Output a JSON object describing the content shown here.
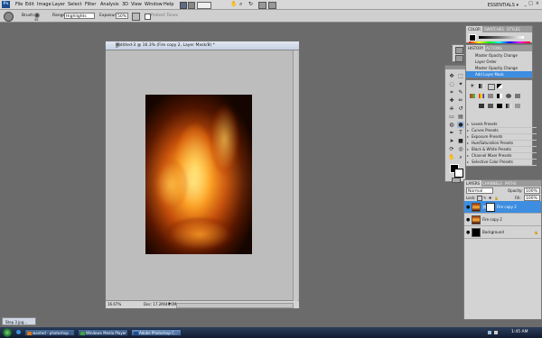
{
  "menu": {
    "ps_logo": "Ps",
    "items": [
      "File",
      "Edit",
      "Image",
      "Layer",
      "Select",
      "Filter",
      "Analysis",
      "3D",
      "View",
      "Window",
      "Help"
    ],
    "workspace": "ESSENTIALS ▾"
  },
  "options": {
    "brush_label": "Brush:",
    "brush_size": "45",
    "range_label": "Range:",
    "range_value": "Highlights",
    "exposure_label": "Exposure:",
    "exposure_value": "50%",
    "protect_tones": "Protect Tones"
  },
  "document": {
    "title": "Untitled-3 @ 16.3% (Fire copy 2, Layer Mask/8) *",
    "zoom": "16.67%",
    "doc_size": "Doc: 17.2M/46.0M"
  },
  "history_panel": {
    "tabs": [
      "HISTORY",
      "ACTIONS"
    ],
    "items": [
      "Master Opacity Change",
      "Layer Order",
      "Master Opacity Change",
      "Add Layer Mask"
    ],
    "selected_index": 3
  },
  "color_panel": {
    "tabs": [
      "COLOR",
      "SWATCHES",
      "STYLES"
    ]
  },
  "adjustments_panel": {
    "items": [
      "Levels Presets",
      "Curves Presets",
      "Exposure Presets",
      "Hue/Saturation Presets",
      "Black & White Presets",
      "Channel Mixer Presets",
      "Selective Color Presets"
    ]
  },
  "layers_panel": {
    "tabs": [
      "LAYERS",
      "CHANNELS",
      "PATHS"
    ],
    "blend_mode": "Normal",
    "opacity_label": "Opacity:",
    "opacity_value": "100%",
    "lock_label": "Lock:",
    "fill_label": "Fill:",
    "fill_value": "100%",
    "layers": [
      {
        "name": "Fire copy 2",
        "selected": true
      },
      {
        "name": "Fire copy 2",
        "selected": false
      },
      {
        "name": "Background",
        "selected": false
      }
    ]
  },
  "minimized_window": "Step 3.jpg...",
  "taskbar": {
    "buttons": [
      "wanted - photoshop ...",
      "Windows Media Player",
      "Adobe Photoshop C..."
    ],
    "clock": "1:45 AM"
  }
}
